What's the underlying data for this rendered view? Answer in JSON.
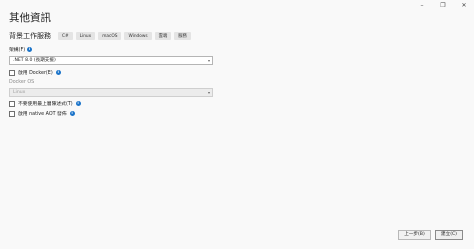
{
  "window": {
    "minimize": "–",
    "maximize": "❐",
    "close": "✕"
  },
  "page": {
    "title": "其他資訊",
    "subtitle": "背景工作服務"
  },
  "tags": [
    "C#",
    "Linux",
    "macOS",
    "Windows",
    "雲端",
    "服務"
  ],
  "framework": {
    "label": "架構(F)",
    "value": ".NET 8.0 (長期支援)"
  },
  "docker": {
    "label": "啟用 Docker(E)"
  },
  "docker_os": {
    "label": "Docker OS",
    "value": "Linux"
  },
  "top_level": {
    "label": "不要使用最上層陳述式(T)"
  },
  "aot": {
    "label": "啟用 native AOT 發佈"
  },
  "footer": {
    "back_label": "上一步(B)",
    "create_label": "建立(C)"
  }
}
